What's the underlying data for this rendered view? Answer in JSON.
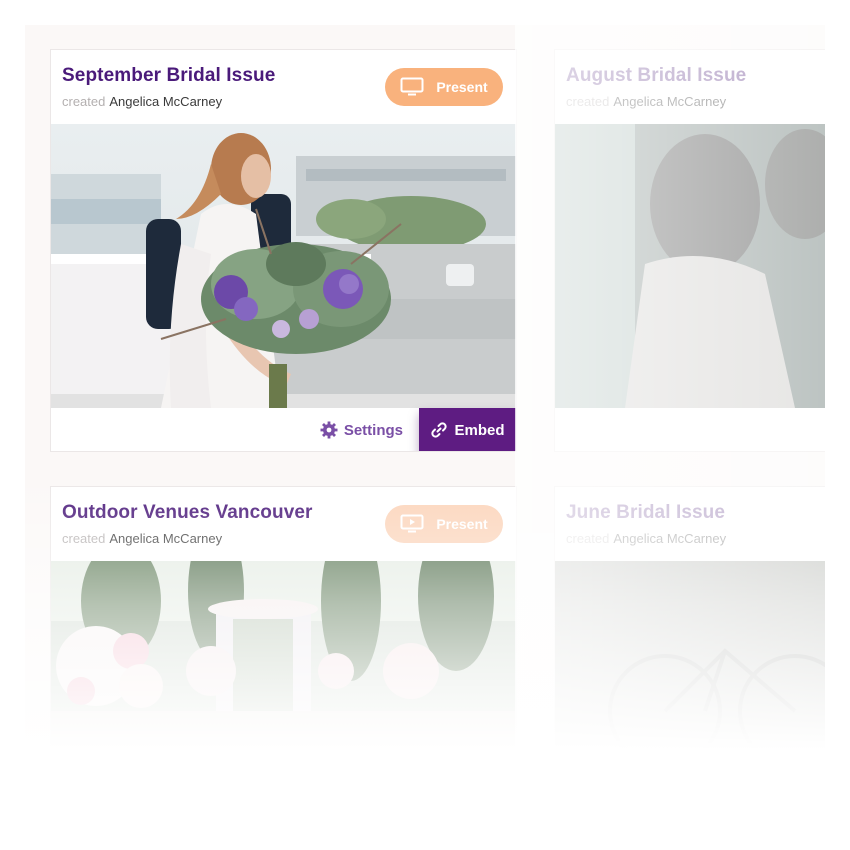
{
  "cards": [
    {
      "title": "September Bridal Issue",
      "created_label": "created",
      "author": "Angelica McCarney",
      "present_label": "Present",
      "settings_label": "Settings",
      "embed_label": "Embed"
    },
    {
      "title": "August Bridal Issue",
      "created_label": "created",
      "author": "Angelica McCarney"
    },
    {
      "title": "Outdoor Venues Vancouver",
      "created_label": "created",
      "author": "Angelica McCarney",
      "present_label": "Present"
    },
    {
      "title": "June Bridal Issue",
      "created_label": "created",
      "author": "Angelica McCarney"
    }
  ],
  "colors": {
    "title_purple": "#4a1a7a",
    "present_orange": "#f9b27d",
    "embed_purple": "#5e1c82",
    "settings_purple": "#7a4fa6"
  },
  "icons": {
    "present": "monitor-play-icon",
    "settings": "gear-icon",
    "embed": "link-icon"
  }
}
